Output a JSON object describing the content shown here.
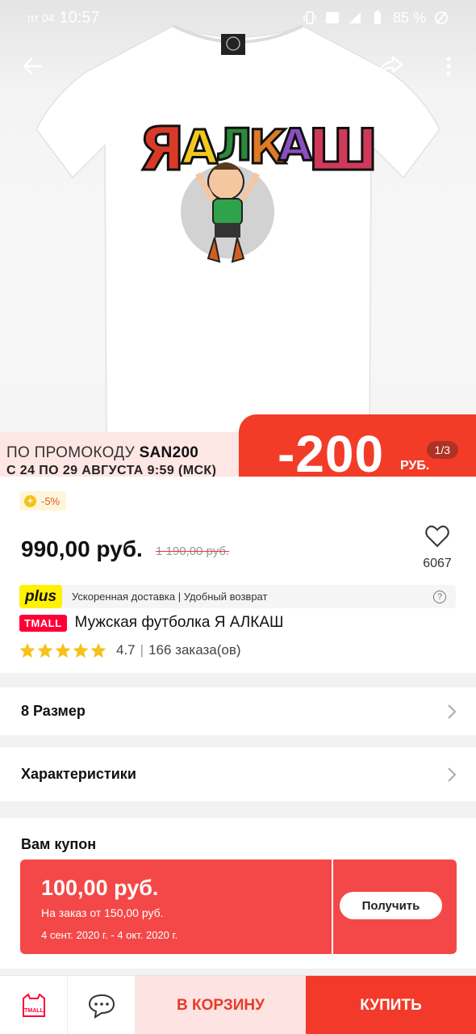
{
  "status_bar": {
    "day": "пт 04",
    "time": "10:57",
    "battery": "85 %"
  },
  "product_image": {
    "print_text": "ЯАЛКАШ",
    "pager": "1/3"
  },
  "promo": {
    "line1_prefix": "ПО ПРОМОКОДУ ",
    "code": "SAN200",
    "line2": "С 24 ПО 29 АВГУСТА 9:59 (МСК)",
    "amount": "-200",
    "currency": "РУБ."
  },
  "discount_badge": "-5%",
  "price": "990,00 руб.",
  "old_price": "1 190,00 руб.",
  "favorites_count": "6067",
  "plus": {
    "logo": "plus",
    "text": "Ускоренная доставка | Удобный возврат"
  },
  "store_badge": "TMALL",
  "title": "Мужская футболка Я АЛКАШ",
  "rating": {
    "stars": 5,
    "value": "4.7",
    "orders": "166 заказа(ов)"
  },
  "rows": {
    "size": "8 Размер",
    "specs": "Характеристики"
  },
  "coupon": {
    "heading": "Вам купон",
    "amount": "100,00 руб.",
    "condition": "На заказ от 150,00 руб.",
    "dates": "4 сент. 2020 г. - 4 окт. 2020 г.",
    "button": "Получить"
  },
  "bottom": {
    "store_icon_label": "TMALL",
    "cart": "В КОРЗИНУ",
    "buy": "КУПИТЬ"
  },
  "colors": {
    "accent": "#f33a2a",
    "coupon": "#f44848",
    "plus": "#fff200",
    "tmall": "#ff0036"
  }
}
